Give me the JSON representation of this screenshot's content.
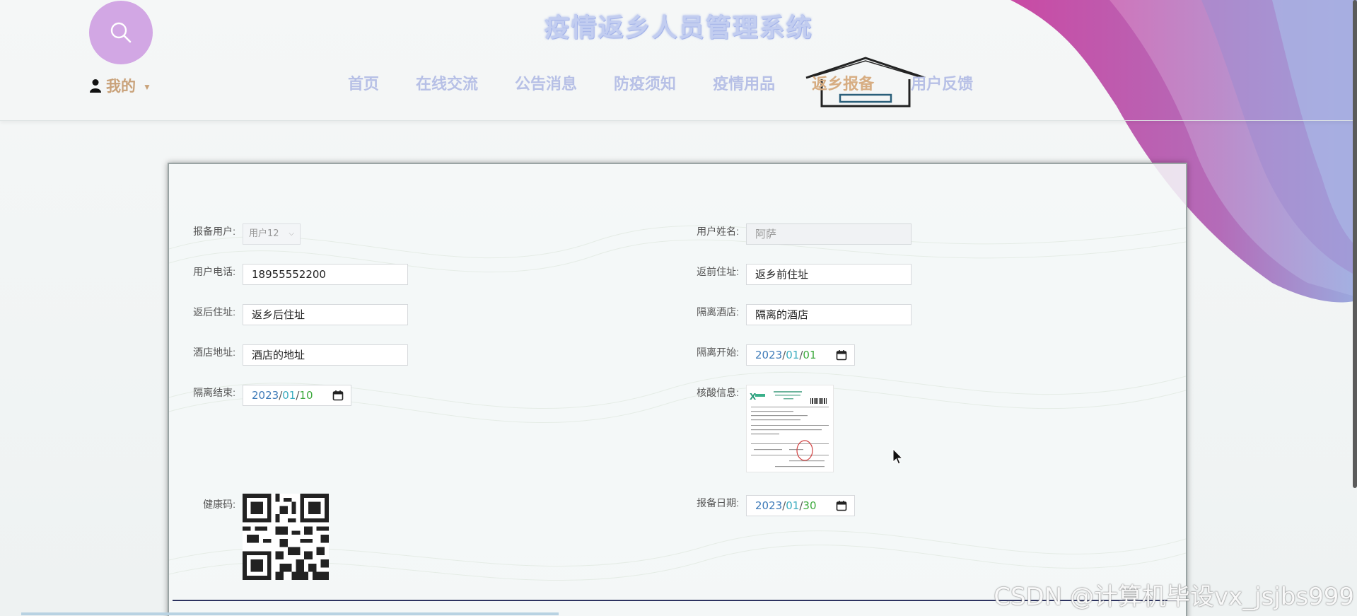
{
  "header": {
    "site_title": "疫情返乡人员管理系统",
    "user_menu_label": "我的"
  },
  "nav": {
    "items": [
      {
        "label": "首页"
      },
      {
        "label": "在线交流"
      },
      {
        "label": "公告消息"
      },
      {
        "label": "防疫须知"
      },
      {
        "label": "疫情用品"
      },
      {
        "label": "返乡报备",
        "active": true
      },
      {
        "label": "用户反馈"
      }
    ]
  },
  "form": {
    "report_user": {
      "label": "报备用户:",
      "value": "用户12"
    },
    "user_name": {
      "label": "用户姓名:",
      "value": "阿萨"
    },
    "user_phone": {
      "label": "用户电话:",
      "value": "18955552200"
    },
    "before_address": {
      "label": "返前住址:",
      "value": "返乡前住址"
    },
    "after_address": {
      "label": "返后住址:",
      "value": "返乡后住址"
    },
    "isolation_hotel": {
      "label": "隔离酒店:",
      "value": "隔离的酒店"
    },
    "hotel_address": {
      "label": "酒店地址:",
      "value": "酒店的地址"
    },
    "isolation_start": {
      "label": "隔离开始:",
      "year": "2023",
      "month": "01",
      "day": "01"
    },
    "isolation_end": {
      "label": "隔离结束:",
      "year": "2023",
      "month": "01",
      "day": "10"
    },
    "nucleic_info": {
      "label": "核酸信息:"
    },
    "health_code": {
      "label": "健康码:"
    },
    "report_date": {
      "label": "报备日期:",
      "year": "2023",
      "month": "01",
      "day": "30"
    }
  },
  "watermark": "CSDN @计算机毕设vx_jsjbs999",
  "colors": {
    "accent_purple": "#d2a7e4",
    "nav_inactive": "#b7c0e6",
    "nav_active": "#d7ad82",
    "title": "#c2cdf0"
  },
  "icons": {
    "search": "search-icon",
    "user": "user-icon",
    "calendar": "calendar-icon"
  }
}
